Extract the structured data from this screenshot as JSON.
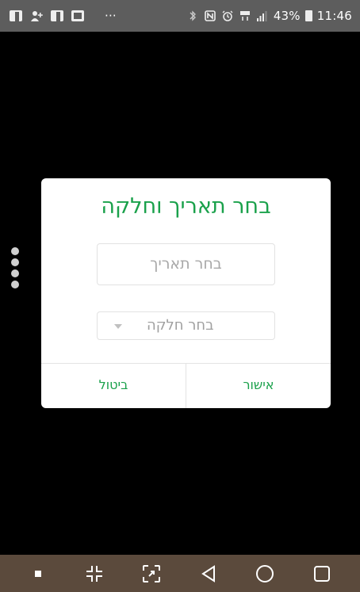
{
  "status_bar": {
    "battery_percent": "43%",
    "time": "11:46",
    "icons": [
      "facebook-icon",
      "add-friend-icon",
      "facebook-icon",
      "image-icon",
      "more-icon",
      "bluetooth-icon",
      "nfc-icon",
      "alarm-icon",
      "lte-icon",
      "signal-icon",
      "battery-icon"
    ]
  },
  "dialog": {
    "title": "בחר תאריך וחלקה",
    "date_placeholder": "בחר תאריך",
    "plot_placeholder": "בחר חלקה",
    "confirm_label": "אישור",
    "cancel_label": "ביטול"
  },
  "nav_bar": {
    "icons": [
      "square-dot-icon",
      "compress-icon",
      "screenshot-icon",
      "back-icon",
      "home-icon",
      "recents-icon"
    ]
  },
  "colors": {
    "accent": "#1aa14b",
    "status_bar": "#5d5d5d",
    "nav_bar": "#5b4a3c",
    "background": "#000000"
  }
}
